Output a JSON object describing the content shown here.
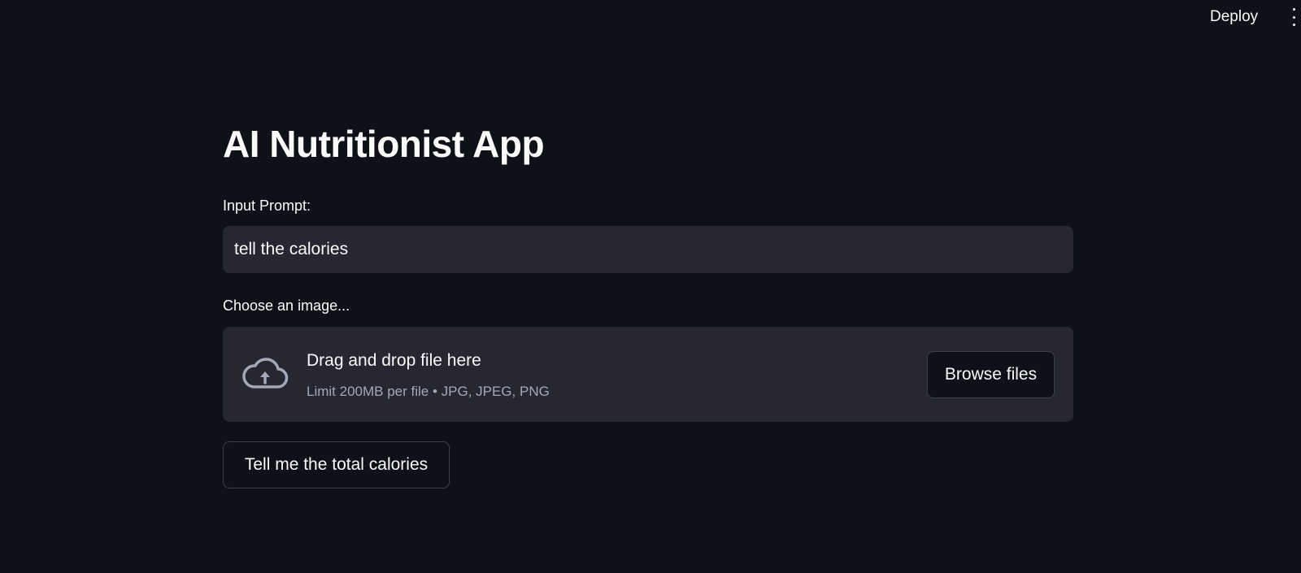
{
  "header": {
    "deploy_label": "Deploy",
    "menu_icon": "vertical-dots-icon"
  },
  "main": {
    "title": "AI Nutritionist App",
    "prompt_label": "Input Prompt:",
    "prompt_value": "tell the calories",
    "uploader_label": "Choose an image...",
    "uploader": {
      "icon": "cloud-upload-icon",
      "title": "Drag and drop file here",
      "subtitle": "Limit 200MB per file • JPG, JPEG, PNG",
      "browse_label": "Browse files"
    },
    "submit_label": "Tell me the total calories"
  },
  "colors": {
    "background": "#0e1117",
    "input_background": "#262730",
    "text": "#fafafa",
    "muted_text": "#a3a8b8"
  }
}
